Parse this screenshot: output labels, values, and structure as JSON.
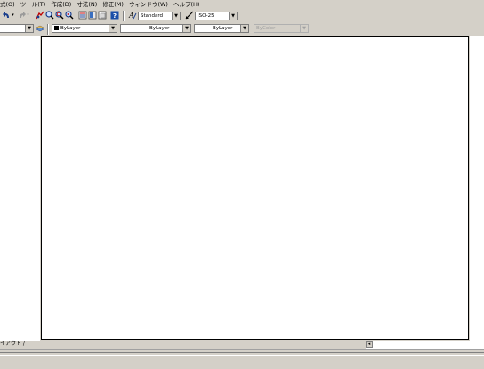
{
  "menubar": {
    "items": [
      "式(O)",
      "ツール(T)",
      "作成(D)",
      "寸法(N)",
      "修正(M)",
      "ウィンドウ(W)",
      "ヘルプ(H)"
    ]
  },
  "toolbar1": {
    "text_style": "Standard",
    "dim_style": "ISO-25"
  },
  "toolbar2": {
    "color": "ByLayer",
    "linetype": "ByLayer",
    "lineweight": "ByLayer",
    "plotstyle": "ByColor"
  },
  "tabbar": {
    "layout_tab": "イアウト /"
  },
  "icons": {
    "undo": "undo-icon",
    "redo": "redo-icon",
    "pan": "pan-icon",
    "zoom": "zoom-icon",
    "properties": "properties-icon",
    "help": "help-icon",
    "text_style": "text-style-icon",
    "dim_style": "dim-style-icon",
    "layer": "layer-icon"
  }
}
